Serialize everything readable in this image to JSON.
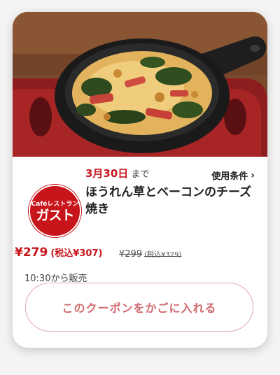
{
  "coupon": {
    "deadline_date": "3月30日",
    "deadline_suffix": "まで",
    "conditions_label": "使用条件",
    "title": "ほうれん草とベーコンのチーズ焼き",
    "price": "¥279",
    "price_tax": "(税込¥307)",
    "original_price": "¥299",
    "original_price_tax": "(税込¥329)",
    "sales_time": "10:30から販売",
    "cart_button_label": "このクーポンをかごに入れる"
  },
  "brand": {
    "logo_top": "Caféレストラン",
    "logo_main": "ガスト",
    "color": "#c8141b"
  },
  "icons": {
    "conditions_chevron": "chevron-right-icon"
  }
}
